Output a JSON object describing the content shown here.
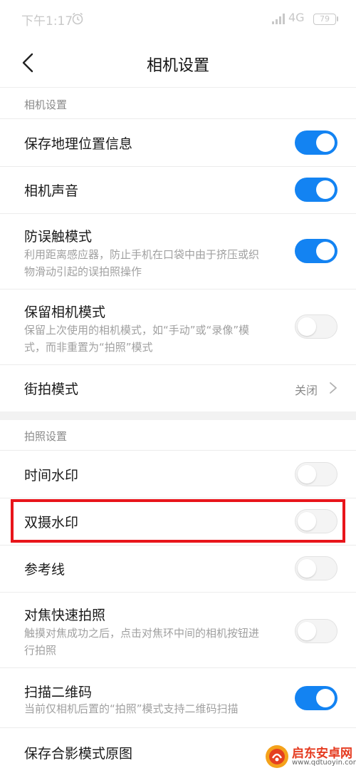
{
  "status_bar": {
    "time": "下午1:17",
    "network": "4G",
    "battery": "79"
  },
  "header": {
    "title": "相机设置"
  },
  "sections": {
    "camera": {
      "label": "相机设置"
    },
    "photo": {
      "label": "拍照设置"
    }
  },
  "rows": {
    "location": {
      "title": "保存地理位置信息",
      "enabled": true
    },
    "sound": {
      "title": "相机声音",
      "enabled": true
    },
    "anti_touch": {
      "title": "防误触模式",
      "desc": "利用距离感应器，防止手机在口袋中由于挤压或织物滑动引起的误拍照操作",
      "enabled": true
    },
    "keep_mode": {
      "title": "保留相机模式",
      "desc": "保留上次使用的相机模式，如“手动”或“录像”模式，而非重置为“拍照”模式",
      "enabled": false
    },
    "street": {
      "title": "街拍模式",
      "value": "关闭"
    },
    "time_watermark": {
      "title": "时间水印",
      "enabled": false
    },
    "dual_watermark": {
      "title": "双摄水印",
      "enabled": false
    },
    "grid": {
      "title": "参考线",
      "enabled": false
    },
    "focus_shot": {
      "title": "对焦快速拍照",
      "desc": "触摸对焦成功之后，点击对焦环中间的相机按钮进行拍照",
      "enabled": false
    },
    "qr_scan": {
      "title": "扫描二维码",
      "desc": "当前仅相机后置的“拍照”模式支持二维码扫描",
      "enabled": true
    },
    "portrait_original": {
      "title": "保存合影模式原图"
    }
  },
  "watermark": {
    "name": "启东安卓网",
    "url": "www.qdtuoyin.com"
  },
  "colors": {
    "accent": "#1383f2",
    "highlight": "#e8151b"
  }
}
